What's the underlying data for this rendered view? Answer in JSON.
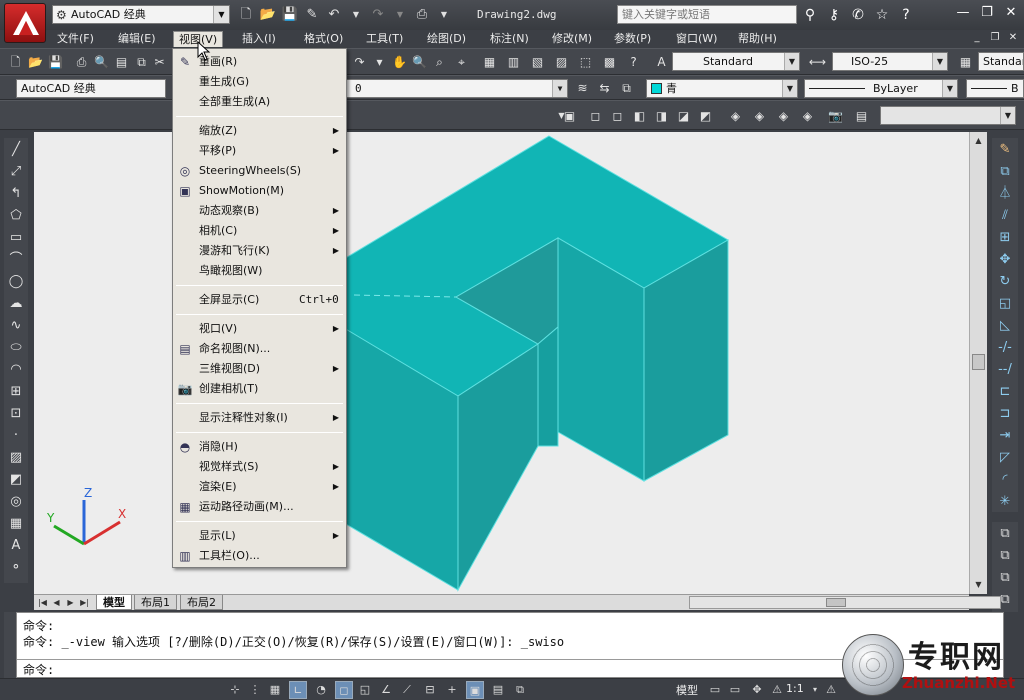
{
  "titlebar": {
    "workspace": "AutoCAD 经典",
    "document_title": "Drawing2.dwg",
    "search_placeholder": "键入关键字或短语"
  },
  "menubar": {
    "items": [
      "文件(F)",
      "编辑(E)",
      "视图(V)",
      "插入(I)",
      "格式(O)",
      "工具(T)",
      "绘图(D)",
      "标注(N)",
      "修改(M)",
      "参数(P)",
      "窗口(W)",
      "帮助(H)"
    ],
    "active": "视图(V)"
  },
  "toolbars": {
    "text_style": "Standard",
    "dim_style": "ISO-25",
    "table_style": "Standard",
    "workspace2": "AutoCAD 经典",
    "layer": "0",
    "color": "青",
    "linetype": "ByLayer",
    "lineweight": "B"
  },
  "view_menu": {
    "items": [
      {
        "label": "重画(R)",
        "icon": "pencil-icon"
      },
      {
        "label": "重生成(G)"
      },
      {
        "label": "全部重生成(A)"
      },
      {
        "sep": true
      },
      {
        "label": "缩放(Z)",
        "submenu": true
      },
      {
        "label": "平移(P)",
        "submenu": true
      },
      {
        "label": "SteeringWheels(S)",
        "icon": "wheel-icon"
      },
      {
        "label": "ShowMotion(M)",
        "icon": "film-icon"
      },
      {
        "label": "动态观察(B)",
        "submenu": true
      },
      {
        "label": "相机(C)",
        "submenu": true
      },
      {
        "label": "漫游和飞行(K)",
        "submenu": true
      },
      {
        "label": "鸟瞰视图(W)"
      },
      {
        "sep": true
      },
      {
        "label": "全屏显示(C)",
        "shortcut": "Ctrl+0"
      },
      {
        "sep": true
      },
      {
        "label": "视口(V)",
        "submenu": true
      },
      {
        "label": "命名视图(N)...",
        "icon": "named-view-icon"
      },
      {
        "label": "三维视图(D)",
        "submenu": true
      },
      {
        "label": "创建相机(T)",
        "icon": "camera-icon"
      },
      {
        "sep": true
      },
      {
        "label": "显示注释性对象(I)",
        "submenu": true
      },
      {
        "sep": true
      },
      {
        "label": "消隐(H)",
        "icon": "hide-icon"
      },
      {
        "label": "视觉样式(S)",
        "submenu": true
      },
      {
        "label": "渲染(E)",
        "submenu": true
      },
      {
        "label": "运动路径动画(M)...",
        "icon": "motion-path-icon"
      },
      {
        "sep": true
      },
      {
        "label": "显示(L)",
        "submenu": true
      },
      {
        "label": "工具栏(O)...",
        "icon": "toolbar-icon"
      }
    ]
  },
  "layout_tabs": [
    "模型",
    "布局1",
    "布局2"
  ],
  "command_window": {
    "line1": "命令:",
    "line2": "命令: _-view 输入选项 [?/删除(D)/正交(O)/恢复(R)/保存(S)/设置(E)/窗口(W)]: _swiso",
    "prompt": "命令:"
  },
  "statusbar": {
    "model_label": "模型",
    "scale": "1:1"
  },
  "ucs_labels": {
    "x": "X",
    "y": "Y",
    "z": "Z"
  },
  "watermark": {
    "cn": "专职网",
    "en": "Zhuanzhi.Net"
  },
  "colors": {
    "solid_top": "#11b5b5",
    "solid_left": "#16a7a7",
    "solid_right": "#1a9d9d",
    "canvas": "#ededed",
    "app_red": "#c82020"
  }
}
